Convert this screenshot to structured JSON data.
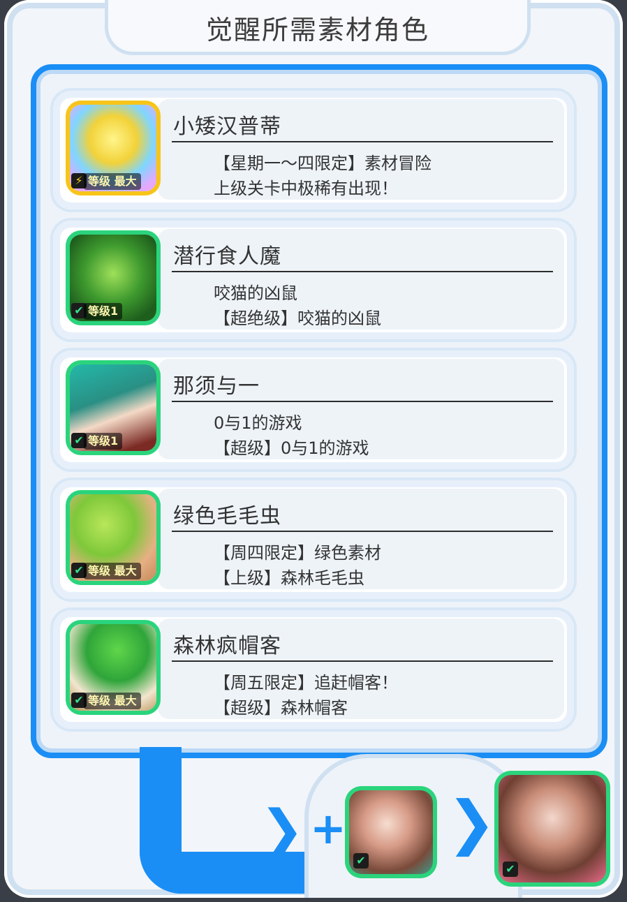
{
  "dialog": {
    "title": "觉醒所需素材角色"
  },
  "materials": [
    {
      "name": "小矮汉普蒂",
      "line1": "【星期一～四限定】素材冒险",
      "line2": "上级关卡中极稀有出现！",
      "badge": "等级 最大",
      "frame_color": "#f7c51a",
      "icon": "gold-egg-creature-icon"
    },
    {
      "name": "潜行食人魔",
      "line1": "咬猫的凶鼠",
      "line2": "【超绝级】咬猫的凶鼠",
      "badge": "等级1",
      "frame_color": "#2bd47c",
      "icon": "green-dragon-icon"
    },
    {
      "name": "那须与一",
      "line1": "0与1的游戏",
      "line2": "【超级】0与1的游戏",
      "badge": "等级1",
      "frame_color": "#2bd47c",
      "icon": "green-hair-character-icon"
    },
    {
      "name": "绿色毛毛虫",
      "line1": "【周四限定】绿色素材",
      "line2": "【上级】森林毛毛虫",
      "badge": "等级 最大",
      "frame_color": "#2bd47c",
      "icon": "green-caterpillar-icon"
    },
    {
      "name": "森林疯帽客",
      "line1": "【周五限定】追赶帽客！",
      "line2": "【超级】森林帽客",
      "badge": "等级 最大",
      "frame_color": "#2bd47c",
      "icon": "green-hatter-icon"
    }
  ],
  "result": {
    "base_icon": "pink-flower-girl-icon",
    "awakened_icon": "awakened-pink-flower-girl-icon",
    "plus_symbol": "+"
  }
}
